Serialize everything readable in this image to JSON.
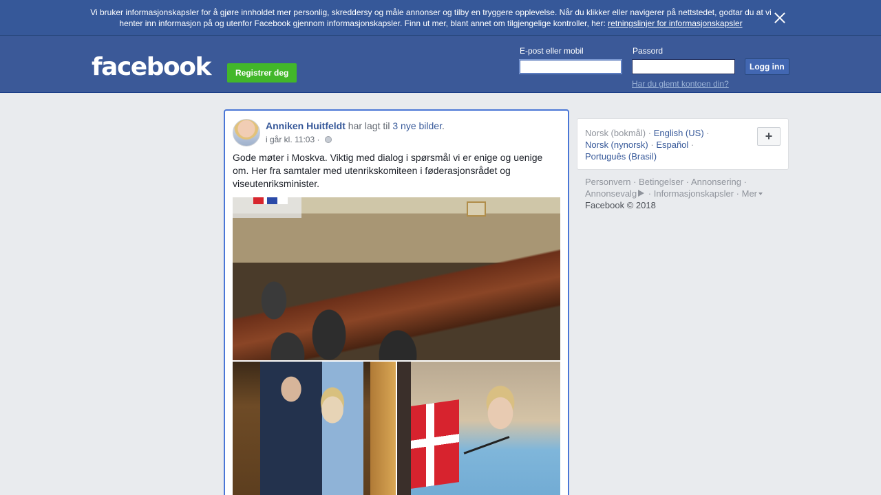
{
  "cookie_banner": {
    "text": "Vi bruker informasjonskapsler for å gjøre innholdet mer personlig, skreddersy og måle annonser og tilby en tryggere opplevelse. Når du klikker eller navigerer på nettstedet, godtar du at vi henter inn informasjon på og utenfor Facebook gjennom informasjonskapsler. Finn ut mer, blant annet om tilgjengelige kontroller, her:",
    "link_label": "retningslinjer for informasjonskapsler"
  },
  "header": {
    "logo": "facebook",
    "register_label": "Registrer deg",
    "email_label": "E-post eller mobil",
    "password_label": "Passord",
    "email_value": "",
    "password_value": "",
    "login_label": "Logg inn",
    "forgot_label": "Har du glemt kontoen din?"
  },
  "post": {
    "author": "Anniken Huitfeldt",
    "verb": "har lagt til",
    "photos_link": "3 nye bilder",
    "period": ".",
    "timestamp": "i går kl. 11:03",
    "separator": "·",
    "text": "Gode møter i Moskva. Viktig med dialog i spørsmål vi er enige og uenige om. Her fra samtaler med utenrikskomiteen i føderasjonsrådet og viseutenriksminister."
  },
  "languages": {
    "current": "Norsk (bokmål)",
    "options": [
      "English (US)",
      "Norsk (nynorsk)",
      "Español",
      "Português (Brasil)"
    ],
    "add_label": "+"
  },
  "footer": {
    "links": [
      "Personvern",
      "Betingelser",
      "Annonsering",
      "Annonsevalg",
      "Informasjonskapsler",
      "Mer"
    ],
    "copyright": "Facebook © 2018"
  },
  "colors": {
    "brand_blue": "#3b5998",
    "banner_blue": "#365899",
    "register_green": "#42b72a",
    "link_blue": "#365899"
  }
}
